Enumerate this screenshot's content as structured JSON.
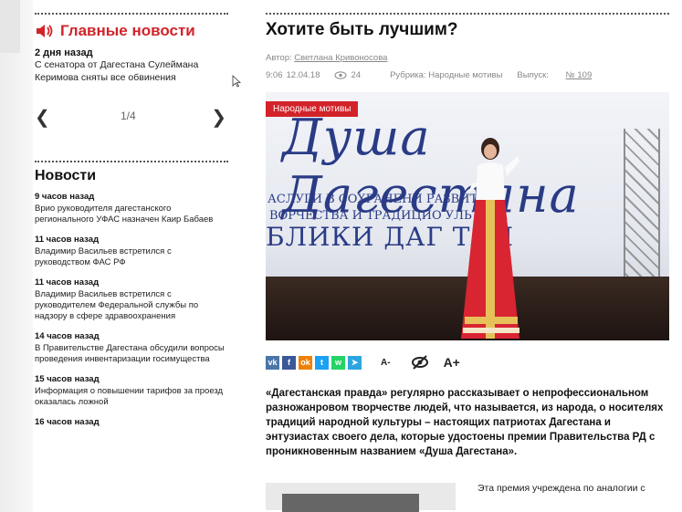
{
  "sidebar": {
    "headline_section": {
      "title": "Главные новости",
      "time": "2 дня назад",
      "text": "С сенатора от Дагестана Сулеймана Керимова сняты все обвинения",
      "pager": "1/4"
    },
    "news": {
      "title": "Новости",
      "items": [
        {
          "time": "9 часов назад",
          "text": "Врио руководителя дагестанского регионального УФАС назначен Каир Бабаев"
        },
        {
          "time": "11 часов назад",
          "text": "Владимир Васильев встретился с руководством ФАС РФ"
        },
        {
          "time": "11 часов назад",
          "text": "Владимир Васильев встретился с руководителем Федеральной службы по надзору в сфере здравоохранения"
        },
        {
          "time": "14 часов назад",
          "text": "В Правительстве Дагестана обсудили вопросы проведения инвентаризации госимущества"
        },
        {
          "time": "15 часов назад",
          "text": "Информация о повышении тарифов за проезд оказалась ложной"
        },
        {
          "time": "16 часов назад",
          "text": ""
        }
      ]
    }
  },
  "article": {
    "title": "Хотите быть лучшим?",
    "author_label": "Автор:",
    "author": "Светлана Кривоносова",
    "time": "9:06",
    "date": "12.04.18",
    "views": "24",
    "rubric": "Рубрика: Народные мотивы",
    "issue_label": "Выпуск:",
    "issue": "№ 109",
    "photo_tag": "Народные мотивы",
    "banner_script": "Душа Дагестана",
    "banner_line1": "АСЛУГИ В СОХРАНЕНИ   РАЗВИТИИ",
    "banner_line2": "ВОРЧЕСТВА И ТРАДИЦИО   УЛЬТУРЫ",
    "banner_big": "БЛИКИ ДАГ   ТАН",
    "font_small": "A-",
    "font_big": "A+",
    "lead": "«Дагестанская правда» регулярно рассказывает о непрофессиональном разножанровом творчестве людей, что называется, из народа, о носителях традиций народной культуры – настоящих патриотах Дагестана и энтузиастах своего дела, которые удостоены премии Правительства РД с проникновенным названием «Душа Дагестана».",
    "continuation": "Эта премия учреждена по аналогии с"
  },
  "share_icons": [
    {
      "name": "vk-share-icon",
      "color": "#4a76a8",
      "glyph": "vk"
    },
    {
      "name": "facebook-share-icon",
      "color": "#3b5998",
      "glyph": "f"
    },
    {
      "name": "odnoklassniki-share-icon",
      "color": "#ee8208",
      "glyph": "ok"
    },
    {
      "name": "twitter-share-icon",
      "color": "#1da1f2",
      "glyph": "t"
    },
    {
      "name": "whatsapp-share-icon",
      "color": "#25d366",
      "glyph": "w"
    },
    {
      "name": "telegram-share-icon",
      "color": "#2ca5e0",
      "glyph": "➤"
    }
  ],
  "colors": {
    "accent": "#d2232a",
    "banner_blue": "#2a3b86"
  }
}
